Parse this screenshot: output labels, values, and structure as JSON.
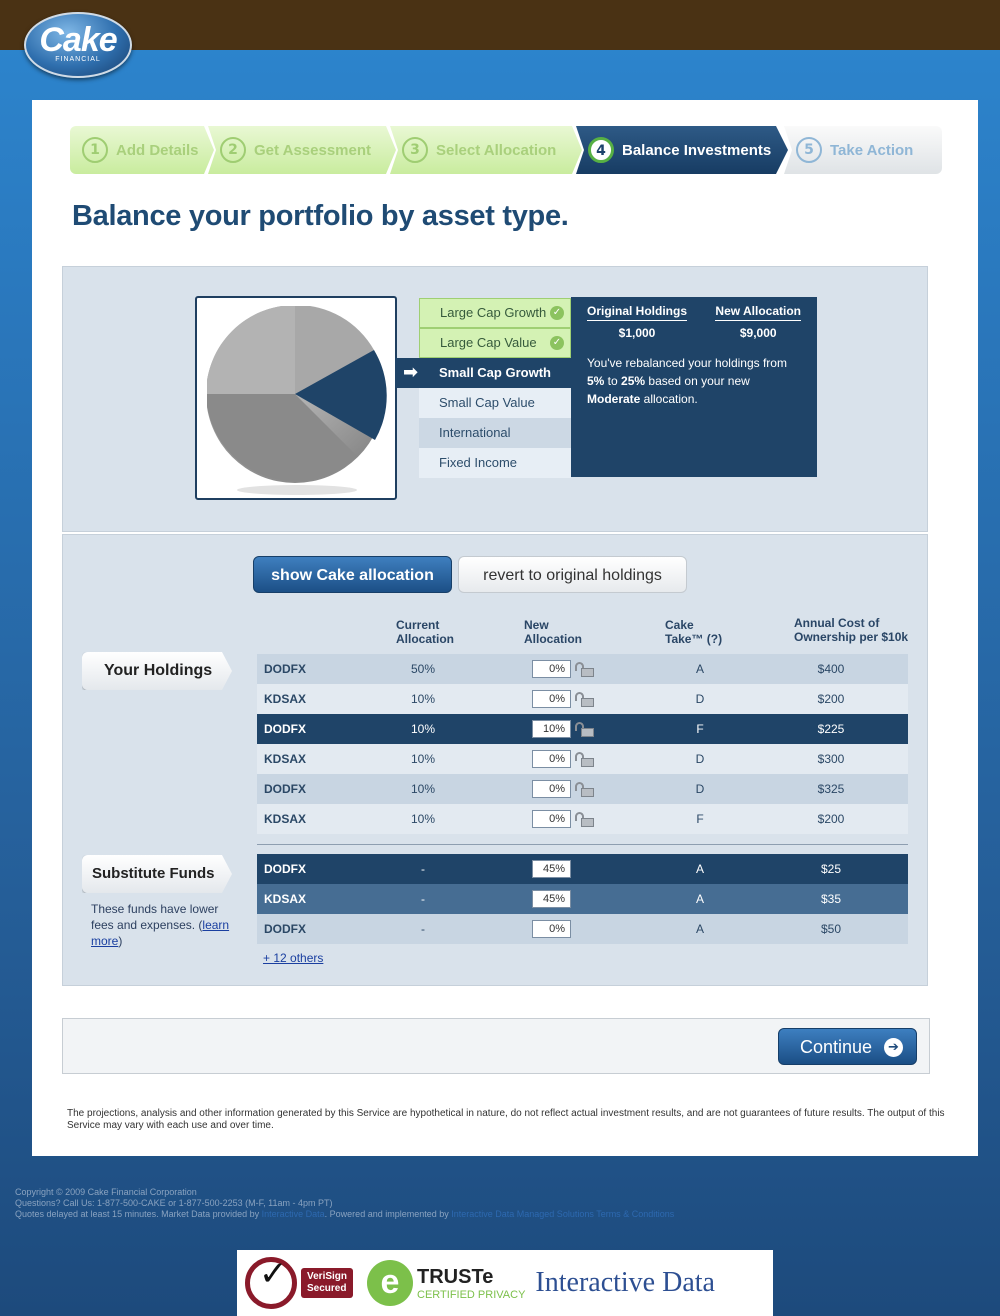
{
  "brand": {
    "logo_main": "Cake",
    "logo_sub": "FINANCIAL"
  },
  "steps": [
    {
      "num": "1",
      "label": "Add Details",
      "state": "done"
    },
    {
      "num": "2",
      "label": "Get Assessment",
      "state": "done"
    },
    {
      "num": "3",
      "label": "Select Allocation",
      "state": "done"
    },
    {
      "num": "4",
      "label": "Balance Investments",
      "state": "active"
    },
    {
      "num": "5",
      "label": "Take Action",
      "state": "todo"
    }
  ],
  "page_title": "Balance your portfolio by asset type.",
  "assets": [
    {
      "label": "Large Cap Growth",
      "state": "done",
      "icon": "check-icon"
    },
    {
      "label": "Large Cap Value",
      "state": "done",
      "icon": "check-icon"
    },
    {
      "label": "Small Cap Growth",
      "state": "active",
      "icon": "arrow-right-icon"
    },
    {
      "label": "Small Cap Value",
      "state": "plain"
    },
    {
      "label": "International",
      "state": "alt"
    },
    {
      "label": "Fixed Income",
      "state": "plain"
    }
  ],
  "detail": {
    "orig_header": "Original Holdings",
    "orig_value": "$1,000",
    "new_header": "New Allocation",
    "new_value": "$9,000",
    "msg_pre": "You've rebalanced your holdings from ",
    "msg_from": "5%",
    "msg_to_word": " to ",
    "msg_to": "25%",
    "msg_mid": " based on your new ",
    "msg_alloc": "Moderate",
    "msg_post": " allocation."
  },
  "buttons": {
    "show_cake": "show Cake allocation",
    "revert": "revert to original holdings",
    "continue": "Continue"
  },
  "table_headers": {
    "current_1": "Current",
    "current_2": "Allocation",
    "new_1": "New",
    "new_2": "Allocation",
    "take_1": "Cake",
    "take_2": "Take™ (?)",
    "cost_1": "Annual Cost of",
    "cost_2": "Ownership per $10k"
  },
  "your_holdings_label": "Your Holdings",
  "holdings": [
    {
      "fund": "DODFX",
      "current": "50%",
      "new": "0%",
      "take": "A",
      "cost": "$400",
      "style": "r-a"
    },
    {
      "fund": "KDSAX",
      "current": "10%",
      "new": "0%",
      "take": "D",
      "cost": "$200",
      "style": "r-b"
    },
    {
      "fund": "DODFX",
      "current": "10%",
      "new": "10%",
      "take": "F",
      "cost": "$225",
      "style": "r-sel"
    },
    {
      "fund": "KDSAX",
      "current": "10%",
      "new": "0%",
      "take": "D",
      "cost": "$300",
      "style": "r-b"
    },
    {
      "fund": "DODFX",
      "current": "10%",
      "new": "0%",
      "take": "D",
      "cost": "$325",
      "style": "r-a"
    },
    {
      "fund": "KDSAX",
      "current": "10%",
      "new": "0%",
      "take": "F",
      "cost": "$200",
      "style": "r-b"
    }
  ],
  "substitute_label": "Substitute Funds",
  "substitute_note": "These funds have lower fees and expenses.",
  "learn_more": "learn more",
  "substitutes": [
    {
      "fund": "DODFX",
      "current": "-",
      "new": "45%",
      "take": "A",
      "cost": "$25",
      "style": "r-sel"
    },
    {
      "fund": "KDSAX",
      "current": "-",
      "new": "45%",
      "take": "A",
      "cost": "$35",
      "style": "r-mid"
    },
    {
      "fund": "DODFX",
      "current": "-",
      "new": "0%",
      "take": "A",
      "cost": "$50",
      "style": "r-a"
    }
  ],
  "others_link": "+ 12 others",
  "disclaimer": "The projections, analysis and other information generated by this Service are hypothetical in nature, do not reflect actual investment results, and are not guarantees of future results. The output of this Service may vary with each use and over time.",
  "footer": {
    "copyright": "Copyright © 2009 Cake Financial Corporation",
    "questions": "Questions? Call Us: 1-877-500-CAKE or 1-877-500-2253 (M-F, 11am - 4pm PT)",
    "quotes_pre": "Quotes delayed at least 15 minutes. Market Data provided by ",
    "quotes_link1": "Interactive Data",
    "quotes_mid": ". Powered and implemented by ",
    "quotes_link2": "Interactive Data Managed Solutions",
    "terms": "Terms & Conditions"
  },
  "badges": {
    "verisign_1": "VeriSign",
    "verisign_2": "Secured",
    "truste_1": "TRUSTe",
    "truste_2": "CERTIFIED PRIVACY",
    "idata": "Interactive Data"
  },
  "colors": {
    "navy": "#1f4468",
    "green": "#9fcd72",
    "brown": "#4a3214"
  }
}
